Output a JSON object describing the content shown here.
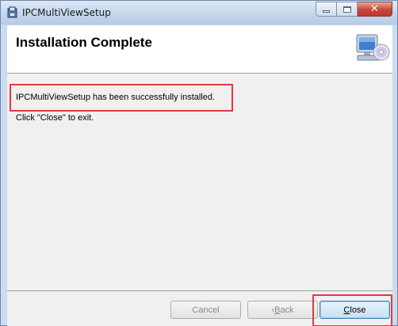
{
  "window": {
    "title": "IPCMultiViewSetup",
    "app_icon": "installer-icon",
    "caption_buttons": {
      "minimize_icon": "minimize-icon",
      "maximize_icon": "maximize-icon",
      "close_glyph": "✕"
    }
  },
  "header": {
    "title": "Installation Complete",
    "icon": "computer-cd-icon"
  },
  "content": {
    "message": "IPCMultiViewSetup has been successfully installed.",
    "instruction": "Click \"Close\" to exit."
  },
  "buttons": {
    "cancel_label": "Cancel",
    "back_arrow": "‹",
    "back_prefix": " ",
    "back_mnemonic": "B",
    "back_rest": "ack",
    "close_mnemonic": "C",
    "close_rest": "lose"
  },
  "colors": {
    "highlight": "#e03a3e",
    "close_btn_border": "#3c7fb1"
  }
}
